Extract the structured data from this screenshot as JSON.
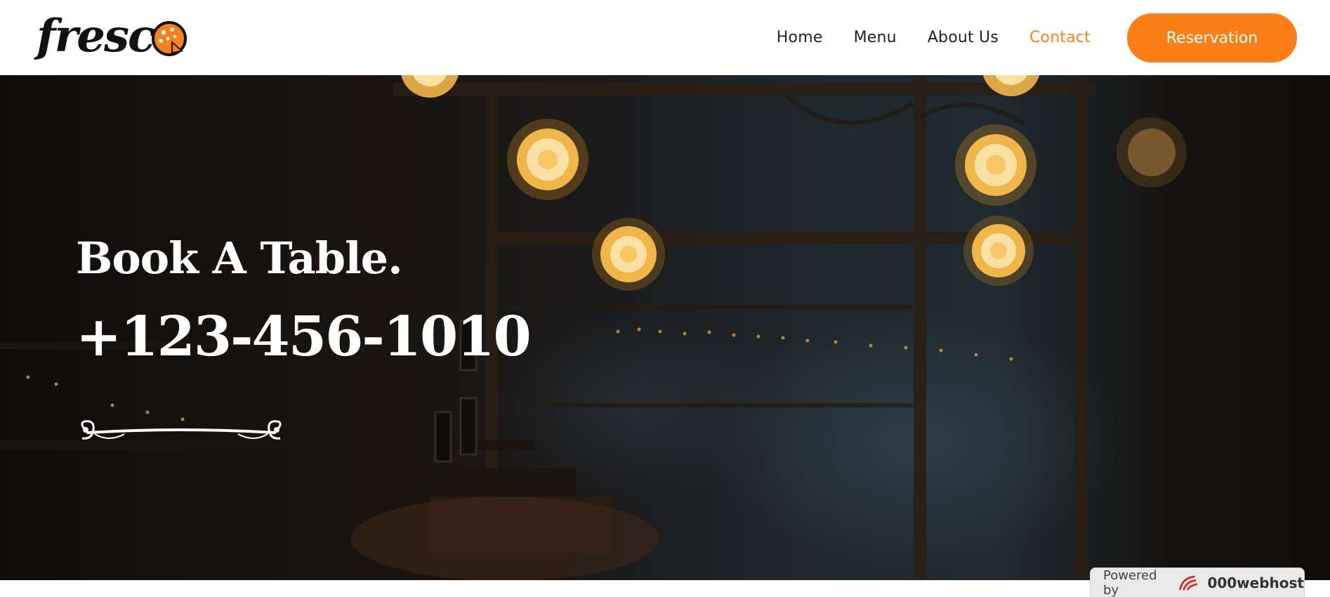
{
  "header": {
    "logo_text": "fresc",
    "nav": [
      {
        "label": "Home"
      },
      {
        "label": "Menu"
      },
      {
        "label": "About Us"
      },
      {
        "label": "Contact",
        "active": true
      }
    ],
    "reservation_label": "Reservation"
  },
  "hero": {
    "title": "Book A Table.",
    "phone": "+123-456-1010",
    "ornament_icon": "flourish-divider-icon"
  },
  "badge": {
    "label": "Powered by",
    "brand": "000webhost",
    "brand_icon": "000webhost-logo-icon"
  },
  "colors": {
    "accent": "#fb7f16",
    "active_nav": "#f7811e",
    "hero_text": "#ffffff"
  }
}
